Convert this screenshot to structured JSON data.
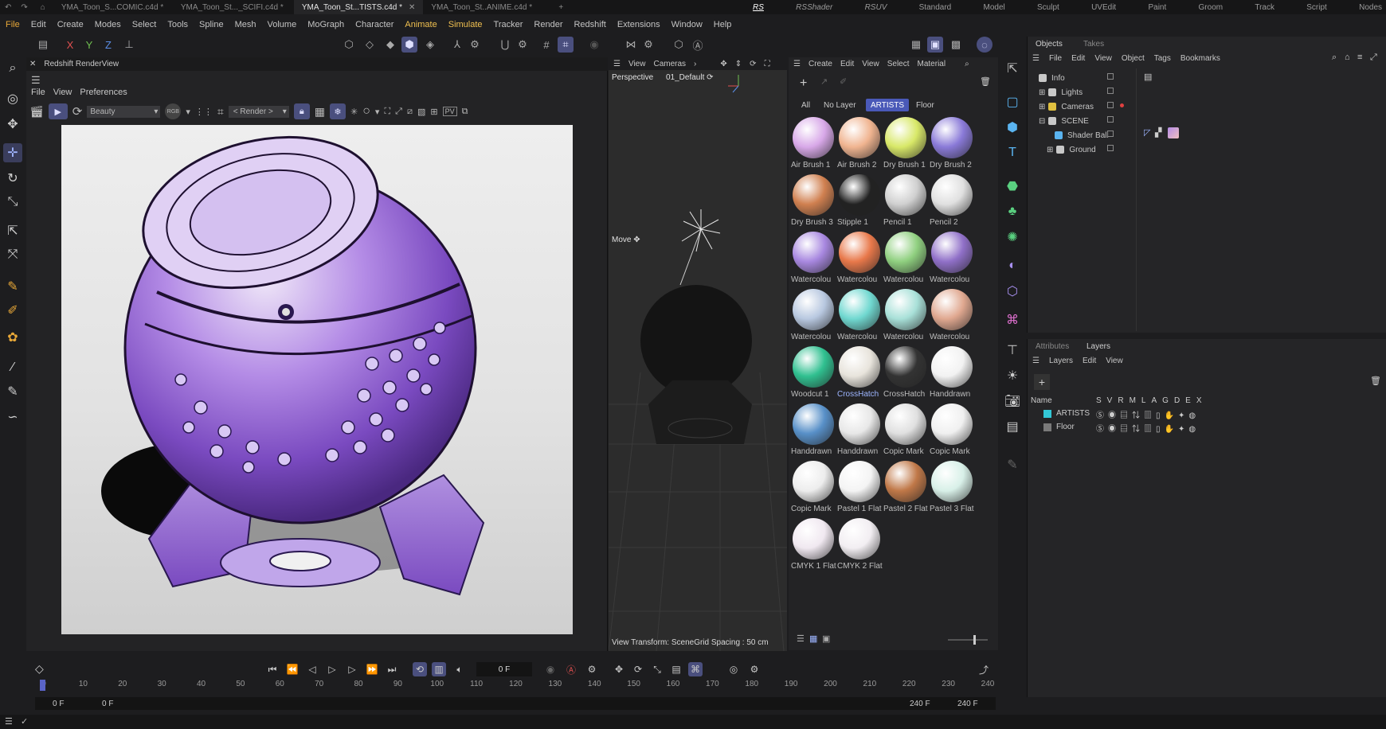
{
  "tabs": [
    {
      "label": "YMA_Toon_S...COMIC.c4d *",
      "active": false
    },
    {
      "label": "YMA_Toon_St..._SCIFI.c4d *",
      "active": false
    },
    {
      "label": "YMA_Toon_St...TISTS.c4d *",
      "active": true
    },
    {
      "label": "YMA_Toon_St..ANIME.c4d *",
      "active": false
    }
  ],
  "layouts": [
    "RS",
    "RSShader",
    "RSUV",
    "Standard",
    "Model",
    "Sculpt",
    "UVEdit",
    "Paint",
    "Groom",
    "Track",
    "Script",
    "Nodes"
  ],
  "menus": [
    "File",
    "Edit",
    "Create",
    "Modes",
    "Select",
    "Tools",
    "Spline",
    "Mesh",
    "Volume",
    "MoGraph",
    "Character",
    "Animate",
    "Simulate",
    "Tracker",
    "Render",
    "Redshift",
    "Extensions",
    "Window",
    "Help"
  ],
  "render_view": {
    "title": "Redshift RenderView",
    "menus": [
      "File",
      "View",
      "Preferences"
    ],
    "aov": "Beauty",
    "mode": "RGB",
    "render_target": "< Render >"
  },
  "viewport": {
    "menus": [
      "View",
      "Cameras"
    ],
    "projection": "Perspective",
    "camera": "01_Default",
    "tool_label": "Move",
    "status": "View Transform: Scene",
    "grid": "Grid Spacing : 50 cm"
  },
  "material_manager": {
    "menus": [
      "Create",
      "Edit",
      "View",
      "Select",
      "Material"
    ],
    "filters": [
      "All",
      "No Layer",
      "ARTISTS",
      "Floor"
    ],
    "active_filter": "ARTISTS",
    "materials": [
      {
        "name": "Air Brush 1",
        "color": "#d8a8e8"
      },
      {
        "name": "Air Brush 2",
        "color": "#f0b490"
      },
      {
        "name": "Dry Brush 1",
        "color": "#d8e868"
      },
      {
        "name": "Dry Brush 2",
        "color": "#8a7ad8"
      },
      {
        "name": "Dry Brush 3",
        "color": "#d08050"
      },
      {
        "name": "Stipple 1",
        "color": "#222222"
      },
      {
        "name": "Pencil 1",
        "color": "#d0d0d0"
      },
      {
        "name": "Pencil 2",
        "color": "#e0e0e0"
      },
      {
        "name": "Watercolou",
        "color": "#a888e0"
      },
      {
        "name": "Watercolou",
        "color": "#e8784a"
      },
      {
        "name": "Watercolou",
        "color": "#90d080"
      },
      {
        "name": "Watercolou",
        "color": "#9070c8"
      },
      {
        "name": "Watercolou",
        "color": "#b8c8e0"
      },
      {
        "name": "Watercolou",
        "color": "#70d8d0"
      },
      {
        "name": "Watercolou",
        "color": "#a8e0d8"
      },
      {
        "name": "Watercolou",
        "color": "#e0a890"
      },
      {
        "name": "Woodcut 1",
        "color": "#30c090"
      },
      {
        "name": "CrossHatch",
        "color": "#e8e4dc"
      },
      {
        "name": "CrossHatch",
        "color": "#333333"
      },
      {
        "name": "Handdrawn",
        "color": "#f2f2f2"
      },
      {
        "name": "Handdrawn",
        "color": "#5890c8"
      },
      {
        "name": "Handdrawn",
        "color": "#e8e8e8"
      },
      {
        "name": "Copic Mark",
        "color": "#e0e0e0"
      },
      {
        "name": "Copic Mark",
        "color": "#f0f0f0"
      },
      {
        "name": "Copic Mark",
        "color": "#ededed"
      },
      {
        "name": "Pastel 1 Flat",
        "color": "#f4f4f4"
      },
      {
        "name": "Pastel 2 Flat",
        "color": "#c07848"
      },
      {
        "name": "Pastel 3 Flat",
        "color": "#d8f0e8"
      },
      {
        "name": "CMYK 1 Flat",
        "color": "#f0e8f0"
      },
      {
        "name": "CMYK 2 Flat",
        "color": "#f2eef2"
      }
    ],
    "selected_material": "CrossHatch"
  },
  "objects_panel": {
    "tabs": [
      "Objects",
      "Takes"
    ],
    "menus": [
      "File",
      "Edit",
      "View",
      "Object",
      "Tags",
      "Bookmarks"
    ],
    "objects": [
      {
        "name": "Info",
        "indent": 0
      },
      {
        "name": "Lights",
        "indent": 0
      },
      {
        "name": "Cameras",
        "indent": 0
      },
      {
        "name": "SCENE",
        "indent": 0
      },
      {
        "name": "Shader Ball",
        "indent": 1
      },
      {
        "name": "Ground",
        "indent": 1
      }
    ]
  },
  "layers_panel": {
    "tabs": [
      "Attributes",
      "Layers"
    ],
    "menus": [
      "Layers",
      "Edit",
      "View"
    ],
    "column_header": "Name",
    "flags": [
      "S",
      "V",
      "R",
      "M",
      "L",
      "A",
      "G",
      "D",
      "E",
      "X"
    ],
    "layers": [
      {
        "name": "ARTISTS",
        "color": "#33c7d6"
      },
      {
        "name": "Floor",
        "color": "#7a7a7a"
      }
    ]
  },
  "timeline": {
    "current_frame": "0 F",
    "ticks": [
      "0",
      "10",
      "20",
      "30",
      "40",
      "50",
      "60",
      "70",
      "80",
      "90",
      "100",
      "110",
      "120",
      "130",
      "140",
      "150",
      "160",
      "170",
      "180",
      "190",
      "200",
      "210",
      "220",
      "230",
      "240"
    ],
    "start": "0 F",
    "min": "0 F",
    "max": "240 F",
    "end": "240 F"
  },
  "colors": {
    "accent": "#4a59b8",
    "selection": "#3a3d5c",
    "background": "#1d1d1f"
  }
}
